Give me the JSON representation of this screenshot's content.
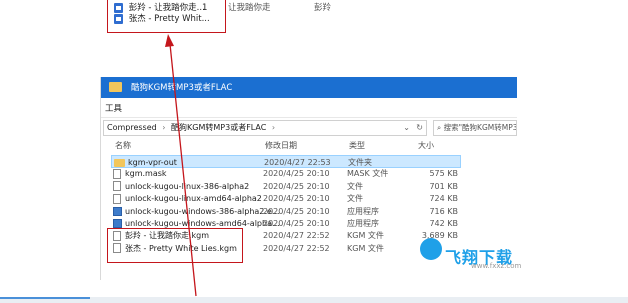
{
  "snippet": {
    "rows": [
      {
        "name": "彭羚 - 让我踏你走...",
        "num": "1",
        "extra": "让我踏你走",
        "artist": "彭羚"
      },
      {
        "name": "张杰 - Pretty Whit..."
      }
    ]
  },
  "window": {
    "title": "酷狗KGM转MP3或者FLAC",
    "menu": "工具",
    "breadcrumb": [
      "Compressed",
      "酷狗KGM转MP3或者FLAC"
    ],
    "search_placeholder": "搜索\"酷狗KGM转MP3或..."
  },
  "columns": {
    "name": "名称",
    "date": "修改日期",
    "type": "类型",
    "size": "大小"
  },
  "files": [
    {
      "icon": "folder",
      "name": "kgm-vpr-out",
      "date": "2020/4/27 22:53",
      "type": "文件夹",
      "size": ""
    },
    {
      "icon": "doc",
      "name": "kgm.mask",
      "date": "2020/4/25 20:10",
      "type": "MASK 文件",
      "size": "575 KB"
    },
    {
      "icon": "doc",
      "name": "unlock-kugou-linux-386-alpha2",
      "date": "2020/4/25 20:10",
      "type": "文件",
      "size": "701 KB"
    },
    {
      "icon": "doc",
      "name": "unlock-kugou-linux-amd64-alpha2",
      "date": "2020/4/25 20:10",
      "type": "文件",
      "size": "724 KB"
    },
    {
      "icon": "exe",
      "name": "unlock-kugou-windows-386-alpha2.e...",
      "date": "2020/4/25 20:10",
      "type": "应用程序",
      "size": "716 KB"
    },
    {
      "icon": "exe",
      "name": "unlock-kugou-windows-amd64-alpha...",
      "date": "2020/4/25 20:10",
      "type": "应用程序",
      "size": "742 KB"
    },
    {
      "icon": "doc",
      "name": "彭羚 - 让我踏你走.kgm",
      "date": "2020/4/27 22:52",
      "type": "KGM 文件",
      "size": "3,689 KB"
    },
    {
      "icon": "doc",
      "name": "张杰 - Pretty White Lies.kgm",
      "date": "2020/4/27 22:52",
      "type": "KGM 文件",
      "size": ""
    }
  ],
  "watermark": {
    "text": "飞翔下载",
    "url": "www.fxxz.com"
  },
  "colors": {
    "titlebar": "#1b6fd1",
    "annotation": "#c4161c",
    "selection": "#cce8ff"
  }
}
